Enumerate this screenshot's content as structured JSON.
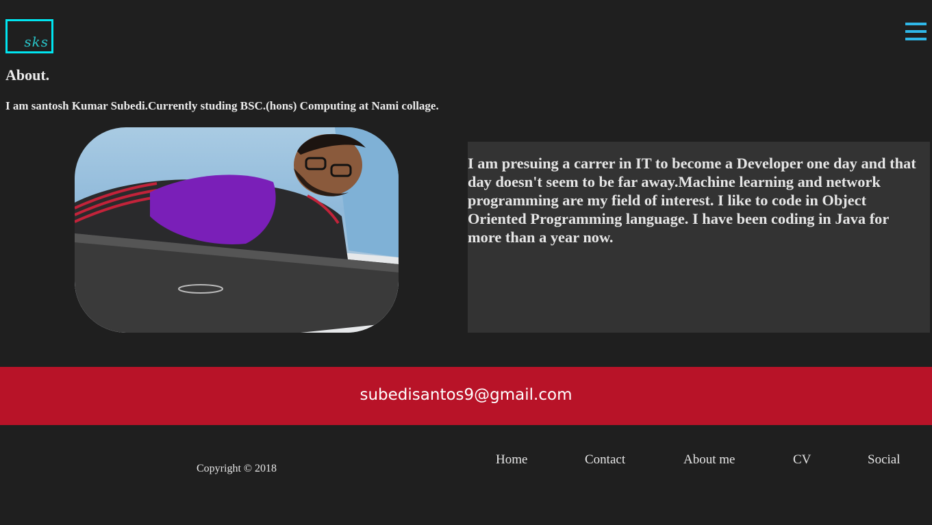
{
  "header": {
    "logo_text": "sks",
    "menu_icon": "hamburger-menu-icon",
    "logo_border_color": "#00e5f0",
    "menu_color": "#2fb7e8"
  },
  "about": {
    "heading": "About.",
    "intro": "I am santosh Kumar Subedi.Currently studing BSC.(hons) Computing at Nami collage.",
    "photo_icon": "profile-photo",
    "bio": "I am presuing a carrer in IT to become a Developer one day and that day doesn't seem to be far away.Machine learning and network programming are my field of interest. I like to code in Object Oriented Programming language. I have been coding in Java for more than a year now."
  },
  "contact": {
    "email": "subedisantos9@gmail.com",
    "band_color": "#b81328"
  },
  "footer": {
    "copyright": "Copyright © 2018",
    "nav": [
      {
        "label": "Home"
      },
      {
        "label": "Contact"
      },
      {
        "label": "About me"
      },
      {
        "label": "CV"
      },
      {
        "label": "Social"
      }
    ]
  }
}
